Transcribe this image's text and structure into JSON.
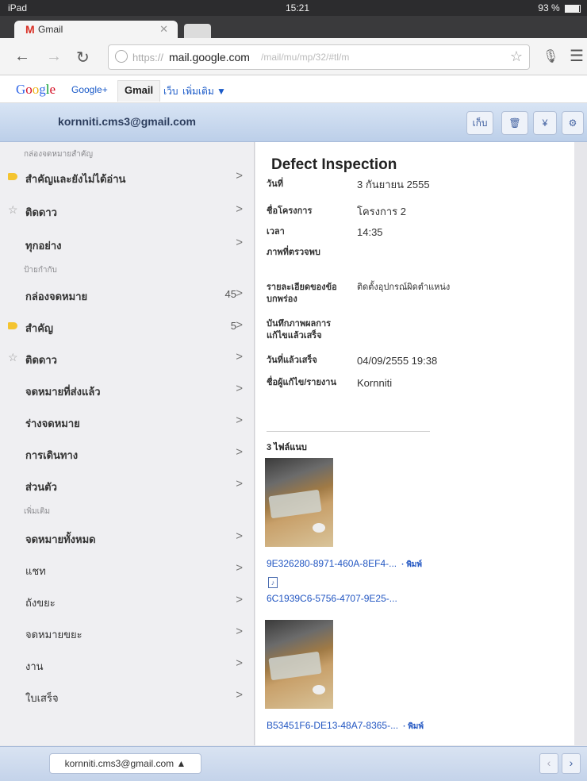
{
  "status_bar": {
    "carrier": "iPad",
    "time": "15:21",
    "battery": "93 %",
    "battery_level": 0.93
  },
  "browser": {
    "tab_title": "Gmail",
    "url_scheme": "https://",
    "url_host": "mail.google.com",
    "url_path": "/mail/mu/mp/32/#tl/m"
  },
  "google_bar": {
    "logo": "Google",
    "links": [
      "Google+",
      "Gmail",
      "เว็บ",
      "เพิ่มเติม ▼"
    ],
    "active": "Gmail"
  },
  "header": {
    "account": "kornniti.cms3@gmail.com",
    "archive_label": "เก็บ"
  },
  "sidebar": {
    "sections": {
      "priority": "กล่องจดหมายสำคัญ",
      "labels": "ป้ายกำกับ",
      "more": "เพิ่มเติม"
    },
    "priority_items": [
      {
        "label": "สำคัญและยังไม่ได้อ่าน",
        "icon": "tag-icon",
        "count": ""
      },
      {
        "label": "ติดดาว",
        "icon": "star-icon",
        "count": ""
      },
      {
        "label": "ทุกอย่าง",
        "icon": "",
        "count": ""
      }
    ],
    "label_items": [
      {
        "label": "กล่องจดหมาย",
        "icon": "",
        "count": "45"
      },
      {
        "label": "สำคัญ",
        "icon": "tag-icon",
        "count": "5"
      },
      {
        "label": "ติดดาว",
        "icon": "star-icon",
        "count": ""
      },
      {
        "label": "จดหมายที่ส่งแล้ว",
        "icon": "",
        "count": ""
      },
      {
        "label": "ร่างจดหมาย",
        "icon": "",
        "count": ""
      },
      {
        "label": "การเดินทาง",
        "icon": "",
        "count": ""
      },
      {
        "label": "ส่วนตัว",
        "icon": "",
        "count": ""
      }
    ],
    "more_items": [
      {
        "label": "จดหมายทั้งหมด",
        "icon": "",
        "count": ""
      },
      {
        "label": "แชท",
        "icon": "",
        "count": ""
      },
      {
        "label": "ถังขยะ",
        "icon": "",
        "count": ""
      },
      {
        "label": "จดหมายขยะ",
        "icon": "",
        "count": ""
      },
      {
        "label": "งาน",
        "icon": "",
        "count": ""
      },
      {
        "label": "ใบเสร็จ",
        "icon": "",
        "count": ""
      }
    ]
  },
  "message": {
    "subject": "Defect Inspection",
    "fields": [
      {
        "key": "วันที่",
        "value": "3 กันยายน 2555"
      },
      {
        "key": "ชื่อโครงการ",
        "value": "โครงการ 2"
      },
      {
        "key": "เวลา",
        "value": "14:35"
      },
      {
        "key": "ภาพที่ตรวจพบ",
        "value": ""
      },
      {
        "key": "รายละเอียดของข้อบกพร่อง",
        "value": "ติดตั้งอุปกรณ์ผิดตำแหน่ง"
      },
      {
        "key": "บันทึกภาพผลการแก้ไขแล้วเสร็จ",
        "value": ""
      },
      {
        "key": "วันที่แล้วเสร็จ",
        "value": "04/09/2555 19:38"
      },
      {
        "key": "ชื่อผู้แก้ไข/รายงาน",
        "value": "Kornniti"
      }
    ],
    "attachments_label": "3 ไฟล์แนบ",
    "attachments": [
      {
        "name": "9E326280-8971-460A-8EF4-...",
        "print": "· พิมพ์"
      },
      {
        "name": "6C1939C6-5756-4707-9E25-...",
        "print": ""
      },
      {
        "name": "B53451F6-DE13-48A7-8365-...",
        "print": "· พิมพ์"
      }
    ]
  },
  "bottom_bar": {
    "account": "kornniti.cms3@gmail.com ▲"
  }
}
